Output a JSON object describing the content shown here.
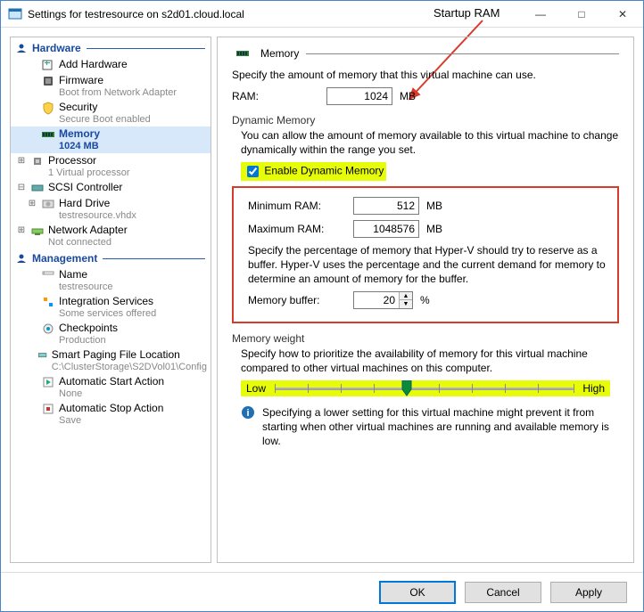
{
  "title": "Settings for testresource on s2d01.cloud.local",
  "callout": "Startup RAM",
  "sidebar": {
    "hardware_header": "Hardware",
    "management_header": "Management",
    "items": {
      "add_hardware": "Add Hardware",
      "firmware": "Firmware",
      "firmware_sub": "Boot from Network Adapter",
      "security": "Security",
      "security_sub": "Secure Boot enabled",
      "memory": "Memory",
      "memory_sub": "1024 MB",
      "processor": "Processor",
      "processor_sub": "1 Virtual processor",
      "scsi": "SCSI Controller",
      "hard_drive": "Hard Drive",
      "hard_drive_sub": "testresource.vhdx",
      "net": "Network Adapter",
      "net_sub": "Not connected",
      "name": "Name",
      "name_sub": "testresource",
      "integration": "Integration Services",
      "integration_sub": "Some services offered",
      "checkpoints": "Checkpoints",
      "checkpoints_sub": "Production",
      "paging": "Smart Paging File Location",
      "paging_sub": "C:\\ClusterStorage\\S2DVol01\\Config",
      "auto_start": "Automatic Start Action",
      "auto_start_sub": "None",
      "auto_stop": "Automatic Stop Action",
      "auto_stop_sub": "Save"
    }
  },
  "panel": {
    "title": "Memory",
    "intro": "Specify the amount of memory that this virtual machine can use.",
    "ram_label": "RAM:",
    "ram_value": "1024",
    "ram_unit": "MB",
    "dyn_header": "Dynamic Memory",
    "dyn_text": "You can allow the amount of memory available to this virtual machine to change dynamically within the range you set.",
    "dyn_checkbox": "Enable Dynamic Memory",
    "min_label": "Minimum RAM:",
    "min_value": "512",
    "max_label": "Maximum RAM:",
    "max_value": "1048576",
    "mb": "MB",
    "buffer_text": "Specify the percentage of memory that Hyper-V should try to reserve as a buffer. Hyper-V uses the percentage and the current demand for memory to determine an amount of memory for the buffer.",
    "buffer_label": "Memory buffer:",
    "buffer_value": "20",
    "buffer_unit": "%",
    "weight_header": "Memory weight",
    "weight_text": "Specify how to prioritize the availability of memory for this virtual machine compared to other virtual machines on this computer.",
    "weight_low": "Low",
    "weight_high": "High",
    "info_text": "Specifying a lower setting for this virtual machine might prevent it from starting when other virtual machines are running and available memory is low."
  },
  "buttons": {
    "ok": "OK",
    "cancel": "Cancel",
    "apply": "Apply"
  }
}
